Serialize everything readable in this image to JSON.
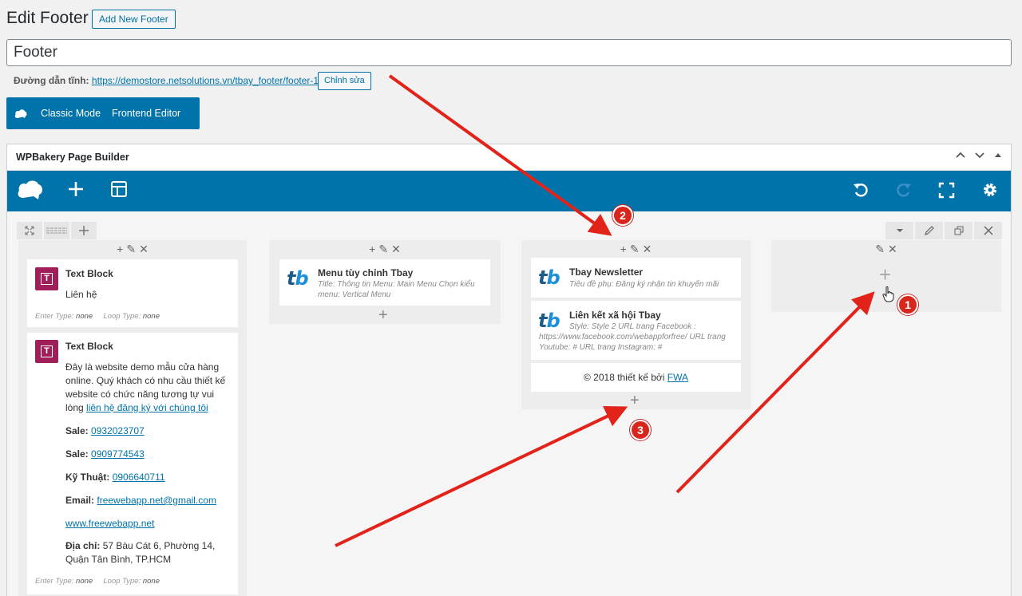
{
  "header": {
    "title": "Edit Footer",
    "add_new_label": "Add New Footer",
    "title_value": "Footer",
    "permalink_label": "Đường dẫn tĩnh:",
    "permalink_url": "https://demostore.netsolutions.vn/tbay_footer/footer-1/",
    "edit_slug_label": "Chỉnh sửa"
  },
  "mode_bar": {
    "classic_label": "Classic Mode",
    "frontend_label": "Frontend Editor"
  },
  "builder": {
    "title": "WPBakery Page Builder",
    "columns": [
      {
        "elements": [
          {
            "name": "Text Block",
            "text": "Liên hệ",
            "enter_type_label": "Enter Type:",
            "enter_type_value": "none",
            "loop_type_label": "Loop Type:",
            "loop_type_value": "none"
          },
          {
            "name": "Text Block",
            "intro": "Đây là website demo mẫu cửa hàng online. Quý khách có nhu cầu thiết kế website có chức năng tương tự vui lòng",
            "intro_link": "liên hệ đăng ký với chúng tôi",
            "sale1_label": "Sale:",
            "sale1_value": "0932023707",
            "sale2_label": "Sale:",
            "sale2_value": "0909774543",
            "tech_label": "Kỹ Thuật:",
            "tech_value": "0906640711",
            "email_label": "Email:",
            "email_value": "freewebapp.net@gmail.com",
            "website": "www.freewebapp.net",
            "address_label": "Địa chỉ:",
            "address_value": "57 Bàu Cát 6, Phường 14, Quận Tân Bình, TP.HCM",
            "enter_type_label": "Enter Type:",
            "enter_type_value": "none",
            "loop_type_label": "Loop Type:",
            "loop_type_value": "none"
          }
        ]
      },
      {
        "elements": [
          {
            "name": "Menu tùy chỉnh Tbay",
            "desc": "Title: Thông tin  Menu: Main Menu  Chọn kiểu menu: Vertical Menu"
          }
        ]
      },
      {
        "elements": [
          {
            "name": "Tbay Newsletter",
            "desc": "Tiêu đề phụ: Đăng ký nhận tin khuyến mãi"
          },
          {
            "name": "Liên kết xã hội Tbay",
            "desc": "Style: Style 2  URL trang Facebook : https://www.facebook.com/webappforfree/  URL trang Youtube: #  URL trang Instagram: #"
          },
          {
            "copyright_text": "© 2018 thiết kế bởi",
            "copyright_link": "FWA"
          }
        ]
      }
    ]
  },
  "badges": [
    "1",
    "2",
    "3"
  ],
  "icons": {
    "logo": "wpbakery-cloud-icon",
    "add": "plus-icon",
    "templates": "layout-icon",
    "undo": "undo-icon",
    "redo": "redo-icon",
    "fullscreen": "fullscreen-icon",
    "settings": "gear-icon"
  },
  "colors": {
    "toolbar": "#0073aa",
    "text_block_icon": "#a01f5a",
    "annotation": "#d9261c"
  }
}
